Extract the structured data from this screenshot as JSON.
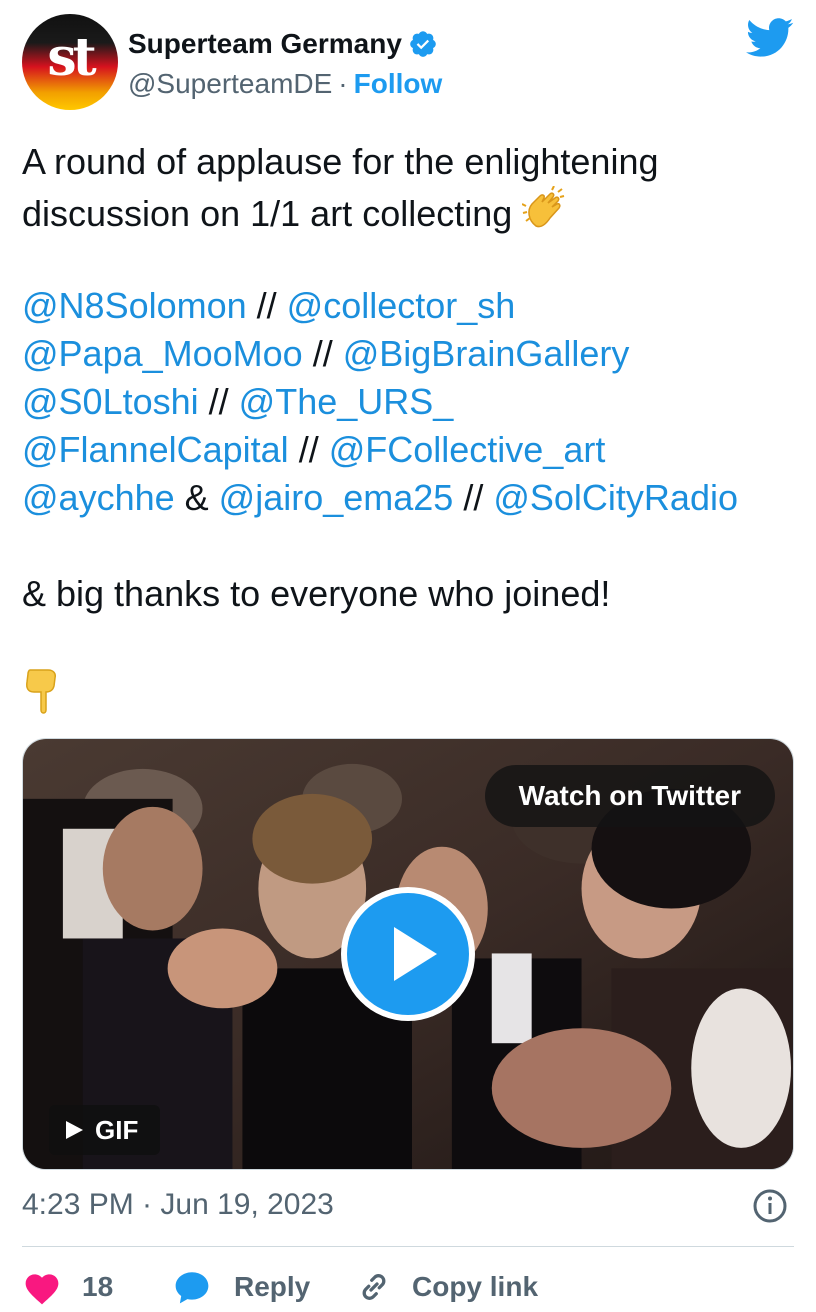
{
  "author": {
    "avatar_text": "st",
    "display_name": "Superteam Germany",
    "handle": "@SuperteamDE",
    "separator": "·",
    "follow_label": "Follow",
    "verified": true
  },
  "tweet": {
    "lines": [
      [
        {
          "t": "text",
          "v": "A round of applause for the enlightening"
        }
      ],
      [
        {
          "t": "text",
          "v": "discussion on 1/1 art collecting "
        },
        {
          "t": "emoji",
          "v": "clapping-hands-icon"
        }
      ],
      [],
      [
        {
          "t": "mention",
          "v": "@N8Solomon"
        },
        {
          "t": "text",
          "v": " // "
        },
        {
          "t": "mention",
          "v": "@collector_sh"
        }
      ],
      [
        {
          "t": "mention",
          "v": "@Papa_MooMoo"
        },
        {
          "t": "text",
          "v": " // "
        },
        {
          "t": "mention",
          "v": "@BigBrainGallery"
        }
      ],
      [
        {
          "t": "mention",
          "v": "@S0Ltoshi"
        },
        {
          "t": "text",
          "v": " // "
        },
        {
          "t": "mention",
          "v": "@The_URS_"
        }
      ],
      [
        {
          "t": "mention",
          "v": "@FlannelCapital"
        },
        {
          "t": "text",
          "v": " // "
        },
        {
          "t": "mention",
          "v": "@FCollective_art"
        }
      ],
      [
        {
          "t": "mention",
          "v": "@aychhe"
        },
        {
          "t": "text",
          "v": " & "
        },
        {
          "t": "mention",
          "v": "@jairo_ema25"
        },
        {
          "t": "text",
          "v": " // "
        },
        {
          "t": "mention",
          "v": "@SolCityRadio"
        }
      ],
      [],
      [
        {
          "t": "text",
          "v": "& big thanks to everyone who joined!"
        }
      ],
      [],
      [
        {
          "t": "emoji",
          "v": "pointing-down-icon"
        }
      ]
    ]
  },
  "media": {
    "watch_label": "Watch on Twitter",
    "gif_label": "GIF"
  },
  "meta": {
    "timestamp": "4:23 PM · Jun 19, 2023"
  },
  "actions": {
    "like_count": "18",
    "reply_label": "Reply",
    "copy_label": "Copy link"
  },
  "colors": {
    "accent": "#1d9bf0",
    "mention": "#1b8fdd",
    "like": "#f91880",
    "muted": "#536471",
    "text": "#0f1419"
  }
}
